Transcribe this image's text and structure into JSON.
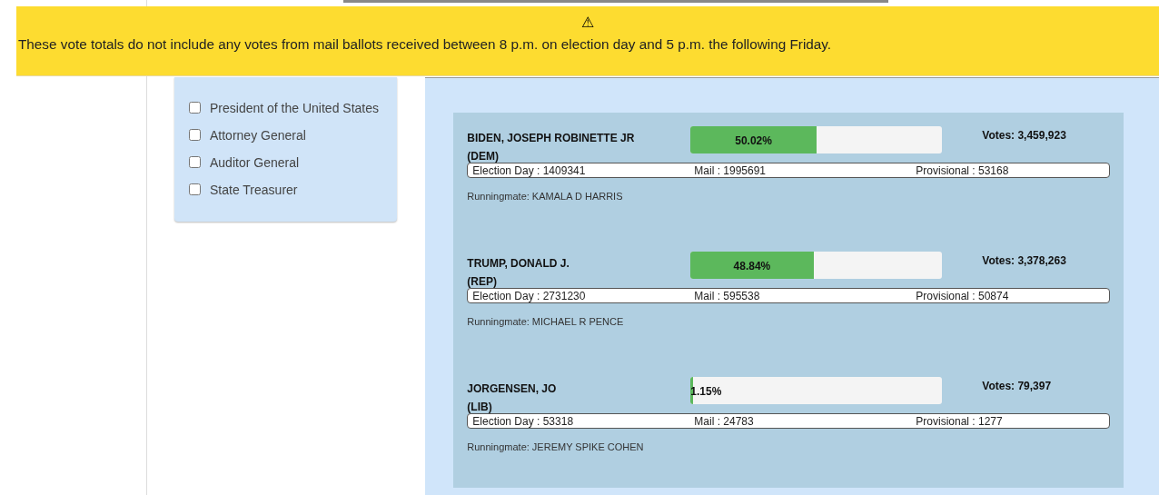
{
  "banner": {
    "icon": "⚠",
    "message": "These vote totals do not include any votes from mail ballots received between 8 p.m. on election day and 5 p.m. the following Friday."
  },
  "offices": [
    {
      "label": "President of the United States",
      "checked": false
    },
    {
      "label": "Attorney General",
      "checked": false
    },
    {
      "label": "Auditor General",
      "checked": false
    },
    {
      "label": "State Treasurer",
      "checked": false
    }
  ],
  "candidates": [
    {
      "name": "BIDEN, JOSEPH ROBINETTE JR",
      "party": "(DEM)",
      "level": 0.5002,
      "percent": "50.02%",
      "votes": "Votes: 3,459,923",
      "election_day": "Election Day : 1409341",
      "mail": "Mail : 1995691",
      "provisional": "Provisional : 53168",
      "runningmate": "Runningmate: KAMALA D HARRIS"
    },
    {
      "name": "TRUMP, DONALD J.",
      "party": "(REP)",
      "level": 0.4884,
      "percent": "48.84%",
      "votes": "Votes: 3,378,263",
      "election_day": "Election Day : 2731230",
      "mail": "Mail : 595538",
      "provisional": "Provisional : 50874",
      "runningmate": "Runningmate: MICHAEL R PENCE"
    },
    {
      "name": "JORGENSEN, JO",
      "party": "(LIB)",
      "level": 0.0115,
      "percent": "1.15%",
      "votes": "Votes: 79,397",
      "election_day": "Election Day : 53318",
      "mail": "Mail : 24783",
      "provisional": "Provisional : 1277",
      "runningmate": "Runningmate: JEREMY SPIKE COHEN"
    }
  ]
}
